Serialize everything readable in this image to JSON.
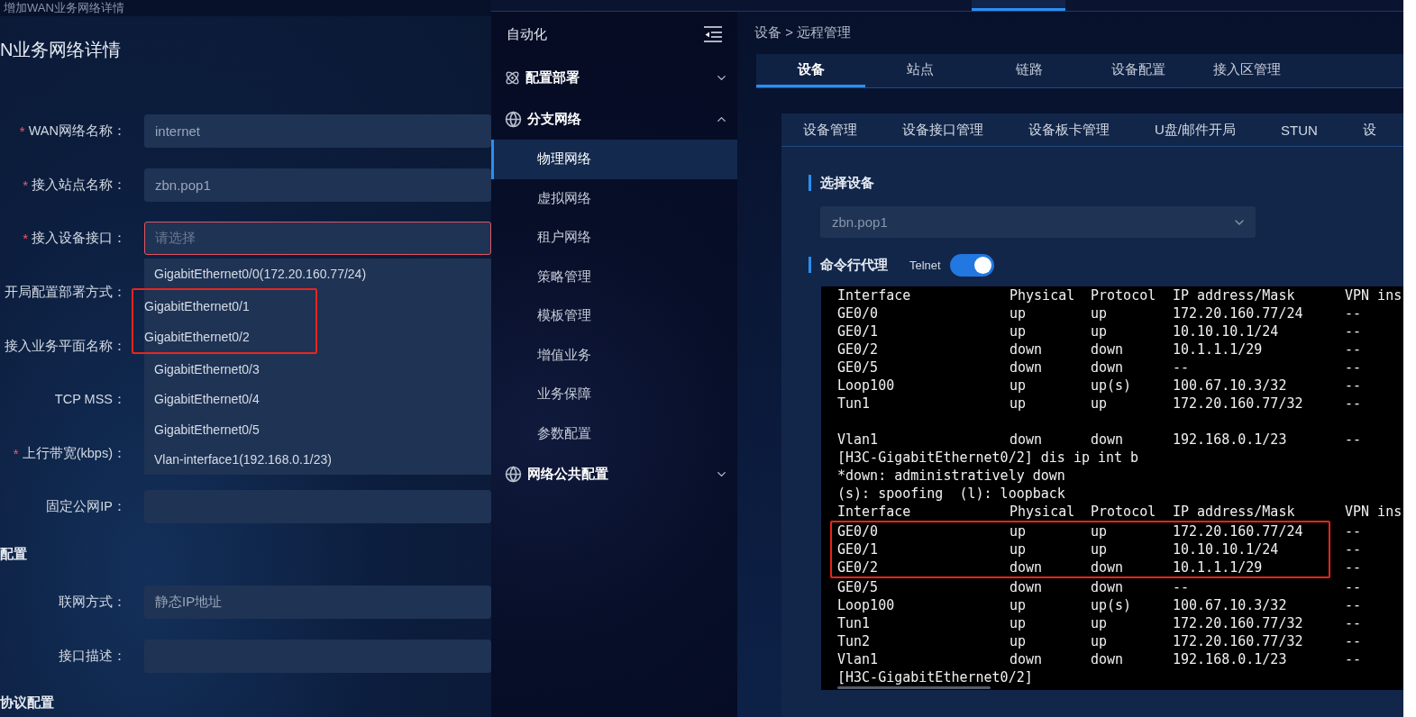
{
  "form_page": {
    "title_bar": "增加WAN业务网络详情",
    "heading": "N业务网络详情",
    "rows": [
      {
        "kind": "field",
        "label": "WAN网络名称：",
        "required_mark": "*",
        "value": "internet",
        "invalid": false
      },
      {
        "kind": "field",
        "label": "接入站点名称：",
        "required_mark": "*",
        "value": "zbn.pop1",
        "invalid": false
      },
      {
        "kind": "field",
        "label": "接入设备接口：",
        "required_mark": "*",
        "placeholder": "请选择",
        "invalid": true
      },
      {
        "kind": "covered",
        "label": "开局配置部署方式："
      },
      {
        "kind": "covered",
        "label": "接入业务平面名称："
      },
      {
        "kind": "covered",
        "label": "TCP MSS："
      },
      {
        "kind": "covered",
        "label": "上行带宽(kbps)：",
        "required_mark": "*"
      },
      {
        "kind": "field",
        "label": "固定公网IP：",
        "invalid": false
      },
      {
        "kind": "section",
        "label": "配置"
      },
      {
        "kind": "field",
        "label": "联网方式：",
        "value": "静态IP地址",
        "invalid": false
      },
      {
        "kind": "field",
        "label": "接口描述：",
        "invalid": false
      },
      {
        "kind": "section",
        "label": "协议配置"
      }
    ],
    "dropdown": {
      "options": [
        {
          "label": "GigabitEthernet0/0(172.20.160.77/24)",
          "marked": false
        },
        {
          "label": "GigabitEthernet0/1",
          "marked": true
        },
        {
          "label": "GigabitEthernet0/2",
          "marked": true
        },
        {
          "label": "GigabitEthernet0/3",
          "marked": false
        },
        {
          "label": "GigabitEthernet0/4",
          "marked": false
        },
        {
          "label": "GigabitEthernet0/5",
          "marked": false
        },
        {
          "label": "Vlan-interface1(192.168.0.1/23)",
          "marked": false
        }
      ]
    }
  },
  "sidebar": {
    "title": "自动化",
    "groups": [
      {
        "label": "配置部署",
        "kind": "atom",
        "expanded": false
      },
      {
        "label": "分支网络",
        "kind": "globe",
        "expanded": true,
        "children": [
          {
            "label": "物理网络",
            "selected": true
          },
          {
            "label": "虚拟网络",
            "selected": false
          },
          {
            "label": "租户网络",
            "selected": false
          },
          {
            "label": "策略管理",
            "selected": false
          },
          {
            "label": "模板管理",
            "selected": false
          },
          {
            "label": "增值业务",
            "selected": false
          },
          {
            "label": "业务保障",
            "selected": false
          },
          {
            "label": "参数配置",
            "selected": false
          }
        ]
      },
      {
        "label": "网络公共配置",
        "kind": "globe",
        "expanded": false
      }
    ]
  },
  "content": {
    "breadcrumb": "设备 > 远程管理",
    "tabs": [
      {
        "label": "设备",
        "selected": true
      },
      {
        "label": "站点",
        "selected": false
      },
      {
        "label": "链路",
        "selected": false
      },
      {
        "label": "设备配置",
        "selected": false
      },
      {
        "label": "接入区管理",
        "selected": false
      }
    ],
    "subtabs": [
      {
        "label": "设备管理"
      },
      {
        "label": "设备接口管理"
      },
      {
        "label": "设备板卡管理"
      },
      {
        "label": "U盘/邮件开局"
      },
      {
        "label": "STUN"
      },
      {
        "label": "设"
      }
    ],
    "device_section": {
      "title": "选择设备",
      "value": "zbn.pop1"
    },
    "cli_section": {
      "title": "命令行代理",
      "switch_label": "Telnet",
      "on": true
    },
    "terminal": {
      "lines": [
        {
          "kind": "row",
          "cells": [
            "Interface",
            "Physical",
            "Protocol",
            "IP address/Mask",
            "VPN ins"
          ],
          "marked": false
        },
        {
          "kind": "row",
          "cells": [
            "GE0/0",
            "up",
            "up",
            "172.20.160.77/24",
            "--"
          ],
          "marked": false
        },
        {
          "kind": "row",
          "cells": [
            "GE0/1",
            "up",
            "up",
            "10.10.10.1/24",
            "--"
          ],
          "marked": false
        },
        {
          "kind": "row",
          "cells": [
            "GE0/2",
            "down",
            "down",
            "10.1.1.1/29",
            "--"
          ],
          "marked": false
        },
        {
          "kind": "row",
          "cells": [
            "GE0/5",
            "down",
            "down",
            "--",
            "--"
          ],
          "marked": false
        },
        {
          "kind": "row",
          "cells": [
            "Loop100",
            "up",
            "up(s)",
            "100.67.10.3/32",
            "--"
          ],
          "marked": false
        },
        {
          "kind": "row",
          "cells": [
            "Tun1",
            "up",
            "up",
            "172.20.160.77/32",
            "--"
          ],
          "marked": false
        },
        {
          "kind": "gap"
        },
        {
          "kind": "row",
          "cells": [
            "Vlan1",
            "down",
            "down",
            "192.168.0.1/23",
            "--"
          ],
          "marked": false
        },
        {
          "kind": "text",
          "text": "[H3C-GigabitEthernet0/2] dis ip int b"
        },
        {
          "kind": "text",
          "text": "*down: administratively down"
        },
        {
          "kind": "text",
          "text": "(s): spoofing  (l): loopback"
        },
        {
          "kind": "row",
          "cells": [
            "Interface",
            "Physical",
            "Protocol",
            "IP address/Mask",
            "VPN ins"
          ],
          "marked": false
        },
        {
          "kind": "row",
          "cells": [
            "GE0/0",
            "up",
            "up",
            "172.20.160.77/24",
            "--"
          ],
          "marked": true
        },
        {
          "kind": "row",
          "cells": [
            "GE0/1",
            "up",
            "up",
            "10.10.10.1/24",
            "--"
          ],
          "marked": true
        },
        {
          "kind": "row",
          "cells": [
            "GE0/2",
            "down",
            "down",
            "10.1.1.1/29",
            "--"
          ],
          "marked": true
        },
        {
          "kind": "row",
          "cells": [
            "GE0/5",
            "down",
            "down",
            "--",
            "--"
          ],
          "marked": false
        },
        {
          "kind": "row",
          "cells": [
            "Loop100",
            "up",
            "up(s)",
            "100.67.10.3/32",
            "--"
          ],
          "marked": false
        },
        {
          "kind": "row",
          "cells": [
            "Tun1",
            "up",
            "up",
            "172.20.160.77/32",
            "--"
          ],
          "marked": false
        },
        {
          "kind": "row",
          "cells": [
            "Tun2",
            "up",
            "up",
            "172.20.160.77/32",
            "--"
          ],
          "marked": false
        },
        {
          "kind": "row",
          "cells": [
            "Vlan1",
            "down",
            "down",
            "192.168.0.1/23",
            "--"
          ],
          "marked": false
        },
        {
          "kind": "text",
          "text": "[H3C-GigabitEthernet0/2]"
        }
      ]
    }
  }
}
